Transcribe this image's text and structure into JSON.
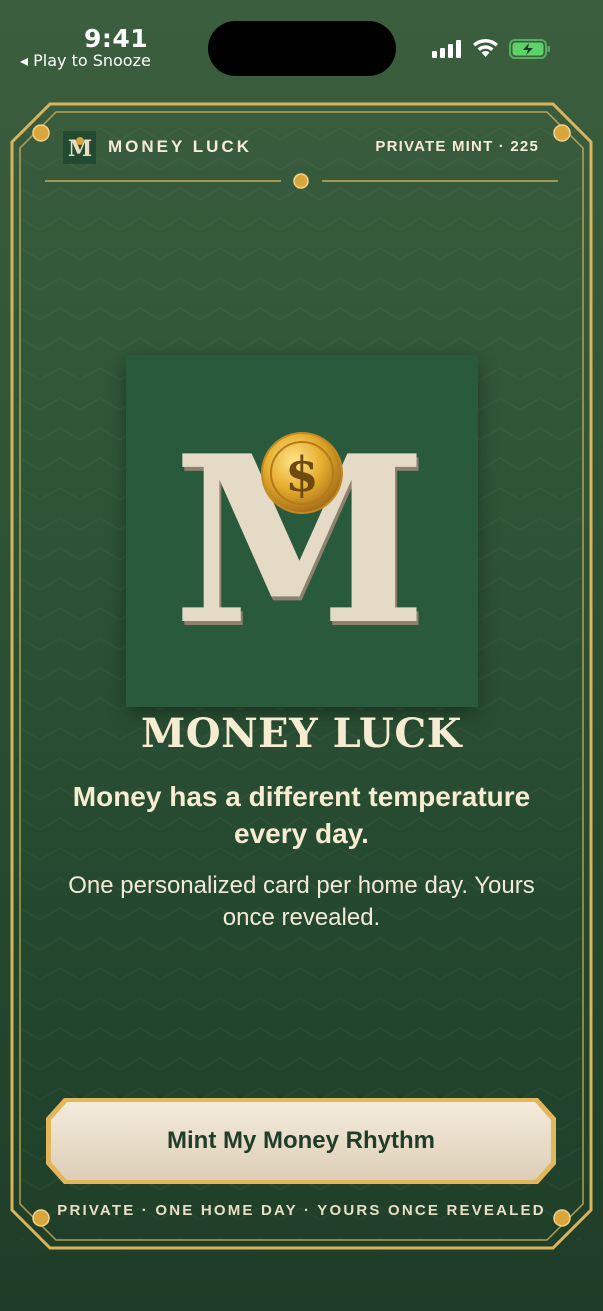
{
  "status_bar": {
    "time": "9:41",
    "back_label": "◂ Play to Snooze"
  },
  "header": {
    "brand": "MONEY LUCK",
    "brand_monogram": "M",
    "mint_label": "PRIVATE MINT · 225"
  },
  "emblem": {
    "letter": "M",
    "coin_symbol": "$"
  },
  "main": {
    "title": "MONEY LUCK",
    "headline": "Money has a different temperature every day.",
    "subtext": "One personalized card per home day. Yours once revealed."
  },
  "cta": {
    "label": "Mint My Money Rhythm"
  },
  "footer": {
    "text": "PRIVATE · ONE HOME DAY · YOURS ONCE REVEALED"
  },
  "colors": {
    "background": "#2f5537",
    "gold": "#d9b45a",
    "cream": "#f6ecd2",
    "button_text": "#1f3d28"
  }
}
